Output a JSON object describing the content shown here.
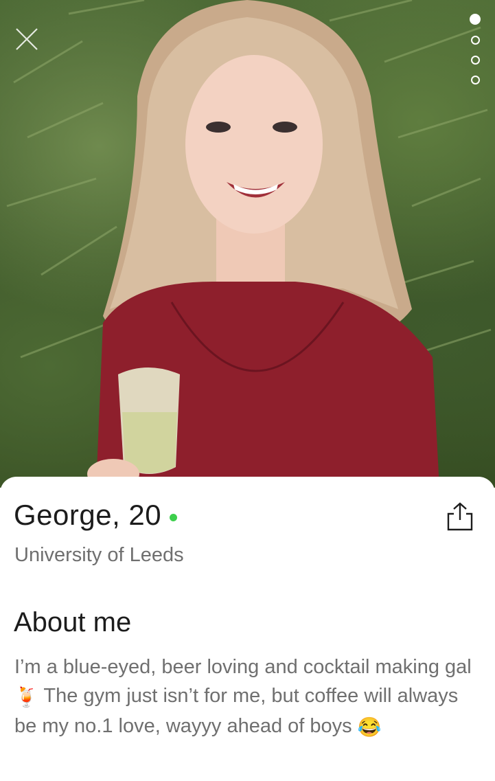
{
  "profile": {
    "name_age": "George, 20",
    "school": "University of Leeds"
  },
  "about": {
    "title": "About me",
    "bio_1": "I’m a blue-eyed, beer loving and cocktail making gal ",
    "emoji_1": "🍹",
    "bio_2": " The gym just isn’t for me, but coffee will always be my no.1 love, wayyy ahead of boys ",
    "emoji_2": "😂"
  },
  "photo_pager": {
    "total": 4,
    "active_index": 0
  },
  "icons": {
    "close": "close-icon",
    "share": "share-icon"
  },
  "colors": {
    "online": "#3dcf4c",
    "text_primary": "#1c1c1c",
    "text_secondary": "#6f6f6f"
  }
}
